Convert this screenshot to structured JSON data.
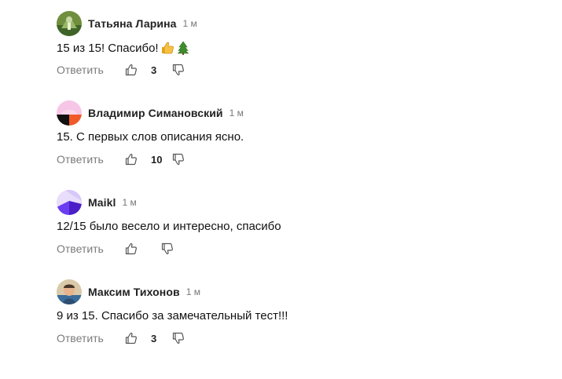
{
  "comments": [
    {
      "author": "Татьяна Ларина",
      "time": "1 м",
      "text": "15 из 15! Спасибо!",
      "reply_label": "Ответить",
      "likes": "3",
      "emoji": [
        "thumbs-up",
        "evergreen-tree"
      ]
    },
    {
      "author": "Владимир Симановский",
      "time": "1 м",
      "text": "15. С первых слов описания ясно.",
      "reply_label": "Ответить",
      "likes": "10"
    },
    {
      "author": "Maikl",
      "time": "1 м",
      "text": "12/15 было весело и интересно, спасибо",
      "reply_label": "Ответить",
      "likes": ""
    },
    {
      "author": "Максим Тихонов",
      "time": "1 м",
      "text": "9 из 15. Спасибо за замечательный тест!!!",
      "reply_label": "Ответить",
      "likes": "3"
    }
  ],
  "icons": {
    "like": "thumbs-up-outline-icon",
    "dislike": "thumbs-down-outline-icon"
  },
  "colors": {
    "reply": "#7b7b7b",
    "author": "#222222",
    "time": "#777777"
  }
}
